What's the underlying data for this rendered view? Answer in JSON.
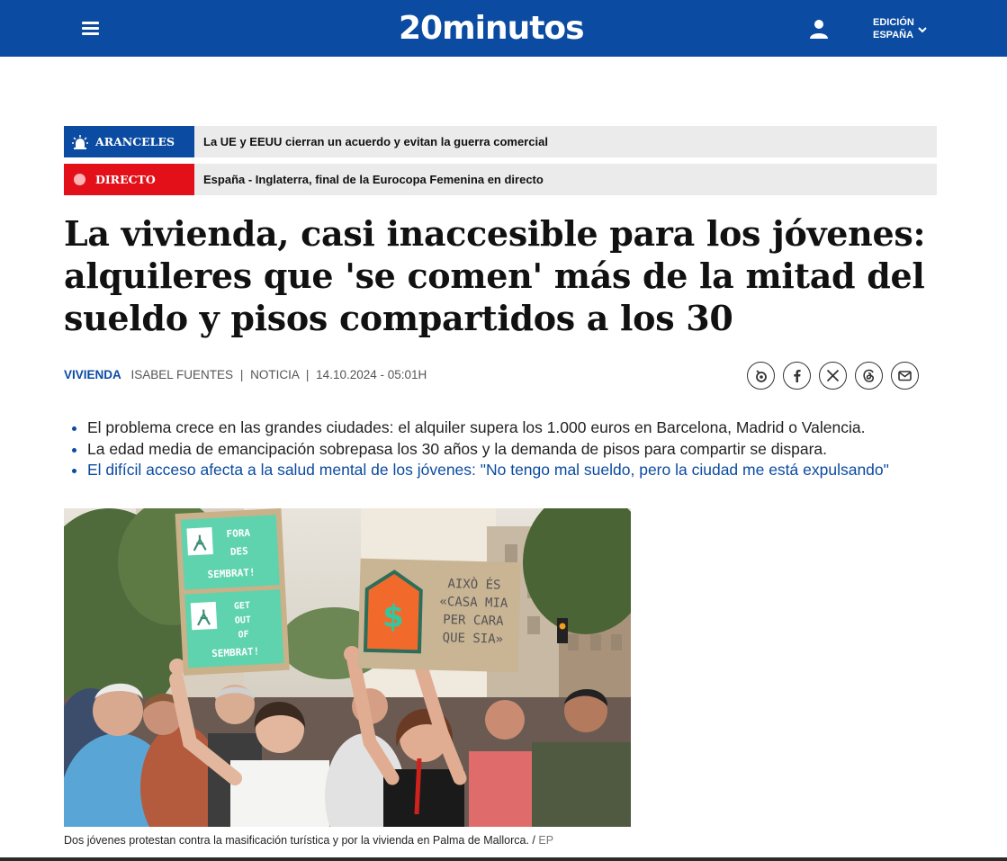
{
  "header": {
    "logo_text": "20minutos",
    "edition_line1": "EDICIÓN",
    "edition_line2": "ESPAÑA",
    "icons": [
      "hamburger-menu-icon",
      "user-icon",
      "chevron-down-icon"
    ],
    "brand_color": "#0b4ba1"
  },
  "breaking": [
    {
      "tag": "ARANCELES",
      "headline": "La UE y EEUU cierran un acuerdo y evitan la guerra comercial",
      "icon": "alarm-light-icon",
      "color": "#0b4ba1"
    },
    {
      "tag": "DIRECTO",
      "headline": "España - Inglaterra, final de la Eurocopa Femenina en directo",
      "icon": "live-dot-icon",
      "color": "#e3101a"
    }
  ],
  "article": {
    "title": "La vivienda, casi inaccesible para los jóvenes: alquileres que 'se comen' más de la mitad del sueldo y pisos compartidos a los 30",
    "section": "VIVIENDA",
    "author": "ISABEL FUENTES",
    "type": "NOTICIA",
    "datetime": "14.10.2024 - 05:01H",
    "separator": "|",
    "share_icons": [
      "bluesky-icon",
      "facebook-icon",
      "x-icon",
      "threads-icon",
      "email-icon"
    ],
    "summary": [
      "El problema crece en las grandes ciudades: el alquiler supera los 1.000 euros en Barcelona, Madrid o Valencia.",
      "La edad media de emancipación sobrepasa los 30 años y la demanda de pisos para compartir se dispara.",
      "El difícil acceso afecta a la salud mental de los jóvenes: \"No tengo mal sueldo, pero la ciudad me está expulsando\""
    ],
    "photo": {
      "sign_left_1": "FORA DES SEMBRAT!",
      "sign_left_2": "GET OUT OF SEMBRAT!",
      "sign_right": "AIXÒ ÉS «CASA MIA PER CARA QUE SIA»",
      "sign_symbol": "$"
    },
    "caption": "Dos jóvenes protestan contra la masificación turística y por la vivienda en Palma de Mallorca.",
    "caption_sep": "/",
    "credit": "EP"
  }
}
